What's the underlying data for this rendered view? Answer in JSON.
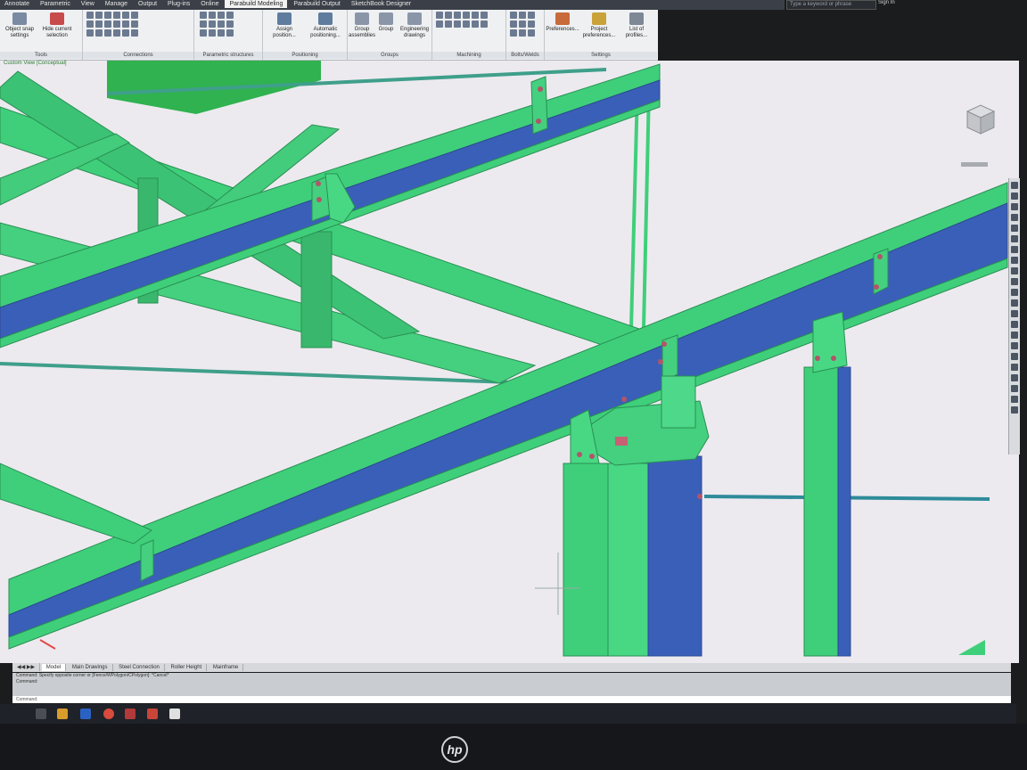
{
  "ribbon": {
    "tabs": [
      "Annotate",
      "Parametric",
      "View",
      "Manage",
      "Output",
      "Plug-ins",
      "Online",
      "Parabuild Modeling",
      "Parabuild Output",
      "SketchBook Designer"
    ],
    "active_tab": "Parabuild Modeling",
    "panels": {
      "tools": {
        "title": "Tools",
        "buttons": [
          "Object snap settings",
          "Hide current selection"
        ]
      },
      "connections": {
        "title": "Connections"
      },
      "parametric": {
        "title": "Parametric structures"
      },
      "positioning": {
        "title": "Positioning",
        "buttons": [
          "Assign position...",
          "Automatic positioning..."
        ]
      },
      "groups": {
        "title": "Groups",
        "buttons": [
          "Group assemblies",
          "Group",
          "Engineering drawings"
        ]
      },
      "machining": {
        "title": "Machining"
      },
      "bolts": {
        "title": "Bolts/Welds"
      },
      "settings": {
        "title": "Settings",
        "buttons": [
          "Preferences...",
          "Project preferences...",
          "List of profiles..."
        ]
      }
    }
  },
  "search": {
    "placeholder": "Type a keyword or phrase"
  },
  "account": {
    "label": "Sign In"
  },
  "viewport": {
    "label": "Custom View [Conceptual]"
  },
  "layout_tabs": [
    "Model",
    "Main Drawings",
    "Steel Connection",
    "Roller Height",
    "Mainframe"
  ],
  "command": {
    "lines": [
      "Command: Specify opposite corner or [Fence/WPolygon/CPolygon]: *Cancel*",
      "Command:"
    ],
    "prompt": "Command:"
  },
  "colors": {
    "steel_green": "#3fcf7a",
    "steel_blue": "#3a5fb8",
    "bolt": "#b2546a",
    "viewport_bg": "#eceaef"
  },
  "brand": "hp"
}
